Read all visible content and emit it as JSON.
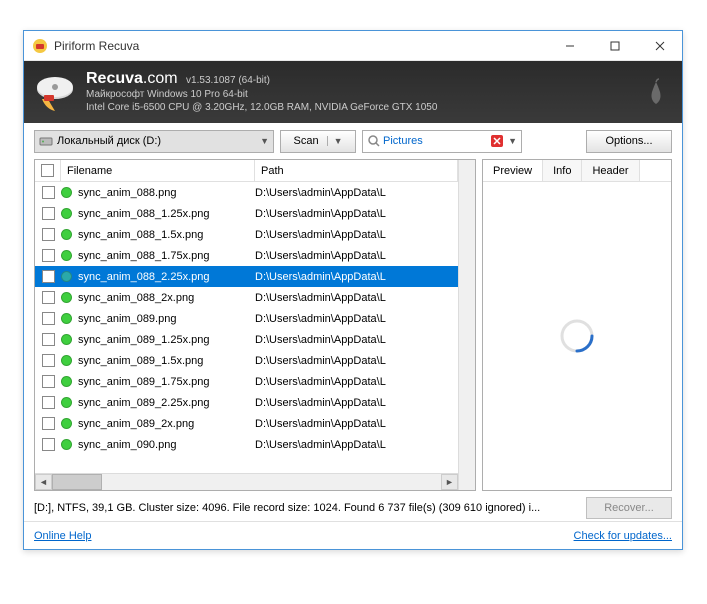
{
  "window": {
    "title": "Piriform Recuva"
  },
  "header": {
    "brand": "Recuva",
    "domain": ".com",
    "version": "v1.53.1087 (64-bit)",
    "os": "Майкрософт Windows 10 Pro 64-bit",
    "hw": "Intel Core i5-6500 CPU @ 3.20GHz, 12.0GB RAM, NVIDIA GeForce GTX 1050"
  },
  "toolbar": {
    "drive": "Локальный диск (D:)",
    "scan": "Scan",
    "filter": "Pictures",
    "options": "Options..."
  },
  "columns": {
    "filename": "Filename",
    "path": "Path"
  },
  "files": [
    {
      "name": "sync_anim_088.png",
      "path": "D:\\Users\\admin\\AppData\\L",
      "status": "green",
      "selected": false
    },
    {
      "name": "sync_anim_088_1.25x.png",
      "path": "D:\\Users\\admin\\AppData\\L",
      "status": "green",
      "selected": false
    },
    {
      "name": "sync_anim_088_1.5x.png",
      "path": "D:\\Users\\admin\\AppData\\L",
      "status": "green",
      "selected": false
    },
    {
      "name": "sync_anim_088_1.75x.png",
      "path": "D:\\Users\\admin\\AppData\\L",
      "status": "green",
      "selected": false
    },
    {
      "name": "sync_anim_088_2.25x.png",
      "path": "D:\\Users\\admin\\AppData\\L",
      "status": "teal",
      "selected": true
    },
    {
      "name": "sync_anim_088_2x.png",
      "path": "D:\\Users\\admin\\AppData\\L",
      "status": "green",
      "selected": false
    },
    {
      "name": "sync_anim_089.png",
      "path": "D:\\Users\\admin\\AppData\\L",
      "status": "green",
      "selected": false
    },
    {
      "name": "sync_anim_089_1.25x.png",
      "path": "D:\\Users\\admin\\AppData\\L",
      "status": "green",
      "selected": false
    },
    {
      "name": "sync_anim_089_1.5x.png",
      "path": "D:\\Users\\admin\\AppData\\L",
      "status": "green",
      "selected": false
    },
    {
      "name": "sync_anim_089_1.75x.png",
      "path": "D:\\Users\\admin\\AppData\\L",
      "status": "green",
      "selected": false
    },
    {
      "name": "sync_anim_089_2.25x.png",
      "path": "D:\\Users\\admin\\AppData\\L",
      "status": "green",
      "selected": false
    },
    {
      "name": "sync_anim_089_2x.png",
      "path": "D:\\Users\\admin\\AppData\\L",
      "status": "green",
      "selected": false
    },
    {
      "name": "sync_anim_090.png",
      "path": "D:\\Users\\admin\\AppData\\L",
      "status": "green",
      "selected": false
    }
  ],
  "tabs": {
    "preview": "Preview",
    "info": "Info",
    "header": "Header"
  },
  "status": "[D:], NTFS, 39,1 GB. Cluster size: 4096. File record size: 1024. Found 6 737 file(s) (309 610 ignored) i...",
  "recover": "Recover...",
  "footer": {
    "help": "Online Help",
    "updates": "Check for updates..."
  },
  "colors": {
    "green": "#3fcf3f",
    "teal": "#2aa9a9",
    "selection": "#0078d7"
  }
}
